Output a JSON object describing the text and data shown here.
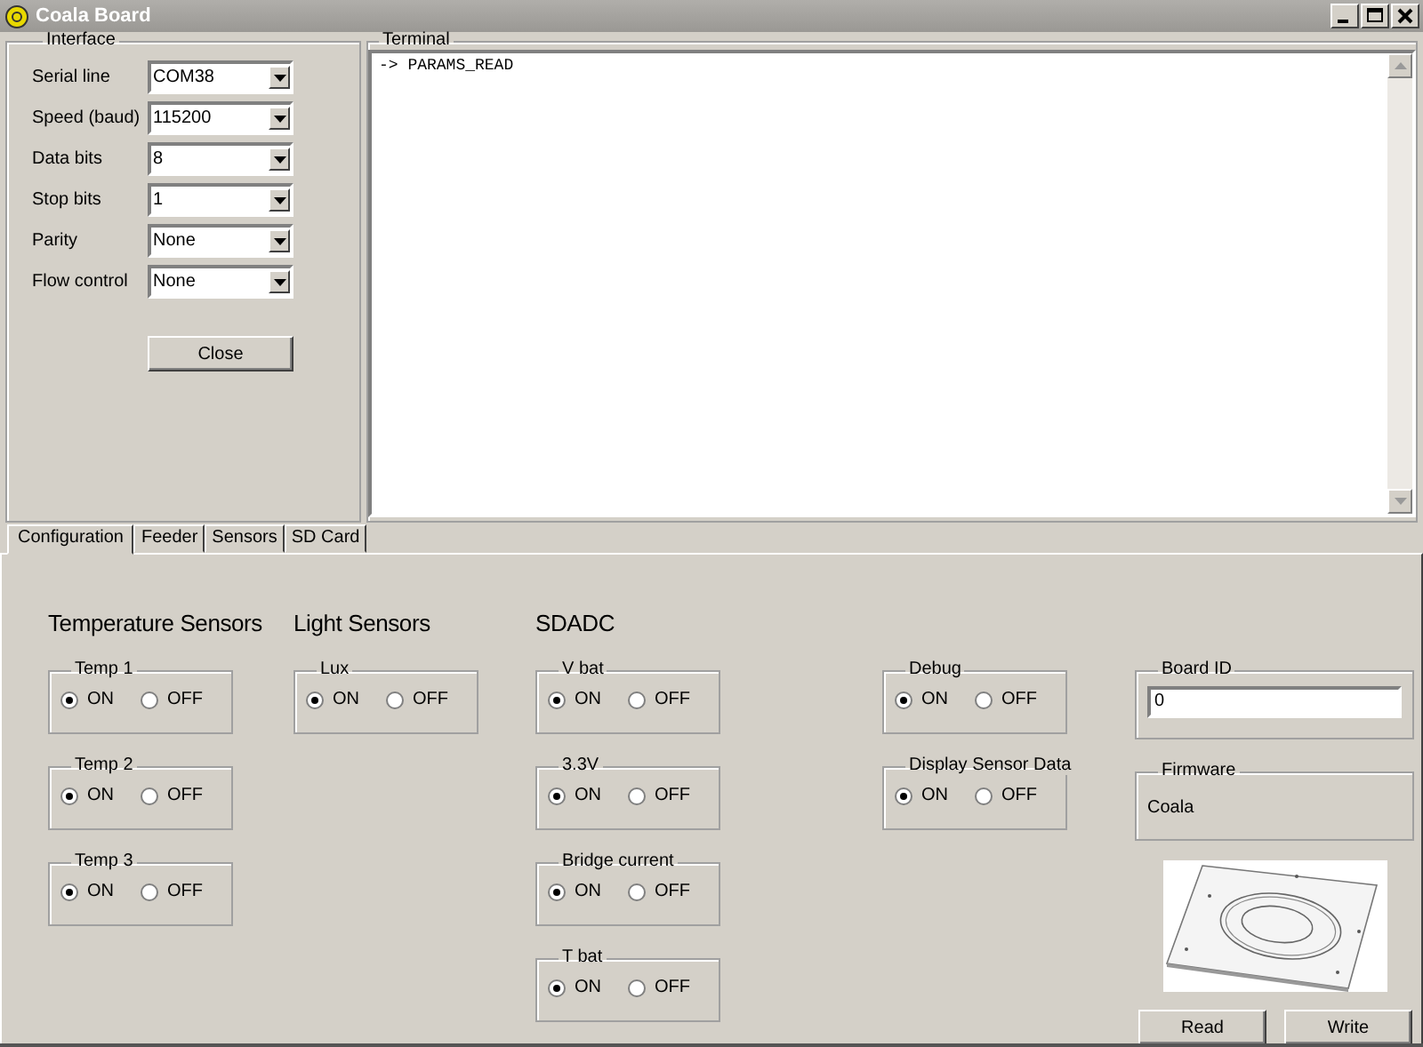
{
  "window": {
    "title": "Coala Board"
  },
  "interface": {
    "title": "Interface",
    "fields": [
      {
        "label": "Serial line",
        "value": "COM38"
      },
      {
        "label": "Speed (baud)",
        "value": "115200"
      },
      {
        "label": "Data bits",
        "value": "8"
      },
      {
        "label": "Stop bits",
        "value": "1"
      },
      {
        "label": "Parity",
        "value": "None"
      },
      {
        "label": "Flow control",
        "value": "None"
      }
    ],
    "button": "Close"
  },
  "terminal": {
    "title": "Terminal",
    "lines": [
      "-> PARAMS_READ"
    ]
  },
  "tabs": [
    {
      "label": "Configuration",
      "selected": true
    },
    {
      "label": "Feeder",
      "selected": false
    },
    {
      "label": "Sensors",
      "selected": false
    },
    {
      "label": "SD Card",
      "selected": false
    }
  ],
  "config": {
    "columns": [
      {
        "heading": "Temperature Sensors",
        "groups": [
          {
            "kind": "radio",
            "label": "Temp 1",
            "options": [
              {
                "label": "ON",
                "selected": true
              },
              {
                "label": "OFF",
                "selected": false
              }
            ]
          },
          {
            "kind": "radio",
            "label": "Temp 2",
            "options": [
              {
                "label": "ON",
                "selected": true
              },
              {
                "label": "OFF",
                "selected": false
              }
            ]
          },
          {
            "kind": "radio",
            "label": "Temp 3",
            "options": [
              {
                "label": "ON",
                "selected": true
              },
              {
                "label": "OFF",
                "selected": false
              }
            ]
          }
        ]
      },
      {
        "heading": "Light Sensors",
        "groups": [
          {
            "kind": "radio",
            "label": "Lux",
            "options": [
              {
                "label": "ON",
                "selected": true
              },
              {
                "label": "OFF",
                "selected": false
              }
            ]
          }
        ]
      },
      {
        "heading": "SDADC",
        "groups": [
          {
            "kind": "radio",
            "label": "V bat",
            "options": [
              {
                "label": "ON",
                "selected": true
              },
              {
                "label": "OFF",
                "selected": false
              }
            ]
          },
          {
            "kind": "radio",
            "label": "3.3V",
            "options": [
              {
                "label": "ON",
                "selected": true
              },
              {
                "label": "OFF",
                "selected": false
              }
            ]
          },
          {
            "kind": "radio",
            "label": "Bridge current",
            "options": [
              {
                "label": "ON",
                "selected": true
              },
              {
                "label": "OFF",
                "selected": false
              }
            ]
          },
          {
            "kind": "radio",
            "label": "T bat",
            "options": [
              {
                "label": "ON",
                "selected": true
              },
              {
                "label": "OFF",
                "selected": false
              }
            ]
          }
        ]
      },
      {
        "groups": [
          {
            "kind": "radio",
            "label": "Debug",
            "options": [
              {
                "label": "ON",
                "selected": true
              },
              {
                "label": "OFF",
                "selected": false
              }
            ]
          },
          {
            "kind": "radio",
            "label": "Display Sensor Data",
            "options": [
              {
                "label": "ON",
                "selected": true
              },
              {
                "label": "OFF",
                "selected": false
              }
            ]
          }
        ]
      },
      {
        "groups": [
          {
            "kind": "field",
            "label": "Board ID",
            "value": "0"
          },
          {
            "kind": "text",
            "label": "Firmware",
            "value": "Coala"
          },
          {
            "kind": "picture"
          }
        ],
        "buttons": [
          "Read",
          "Write"
        ]
      }
    ]
  }
}
